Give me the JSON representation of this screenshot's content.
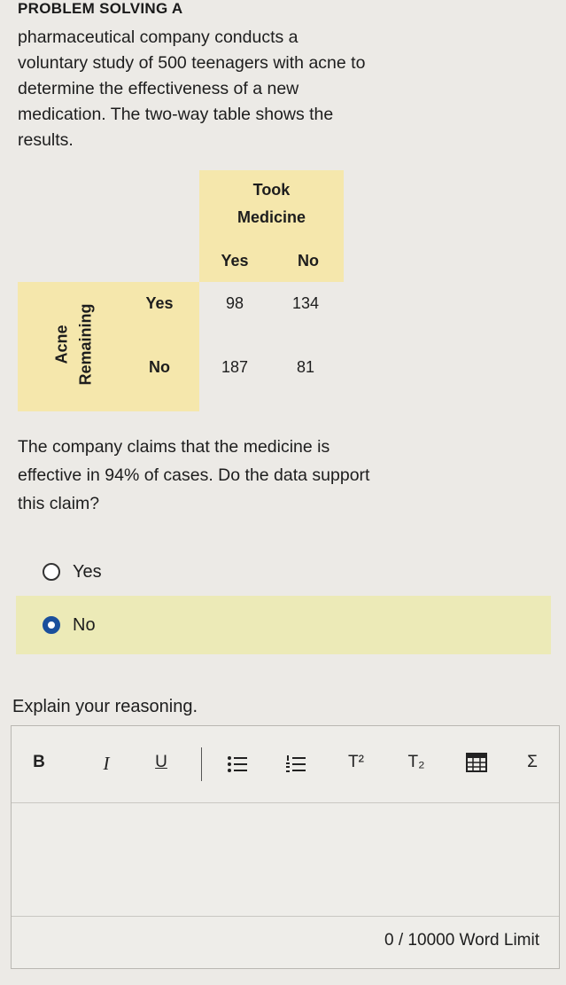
{
  "problem": {
    "title": "PROBLEM SOLVING A",
    "text": "pharmaceutical company conducts a voluntary study of 500 teenagers with acne to determine the effectiveness of a new medication. The two-way table shows the results."
  },
  "two_way_table": {
    "column_header_line1": "Took",
    "column_header_line2": "Medicine",
    "column_yes": "Yes",
    "column_no": "No",
    "row_header_line1": "Acne",
    "row_header_line2": "Remaining",
    "row_yes": "Yes",
    "row_no": "No",
    "cells": {
      "yes_yes": "98",
      "yes_no": "134",
      "no_yes": "187",
      "no_no": "81"
    }
  },
  "question": {
    "text": "The company claims that the medicine is effective in 94% of cases. Do the data support this claim?",
    "options": [
      {
        "label": "Yes",
        "selected": false
      },
      {
        "label": "No",
        "selected": true
      }
    ]
  },
  "explain": {
    "prompt": "Explain your reasoning.",
    "toolbar": {
      "bold": "B",
      "italic": "I",
      "underline": "U",
      "superscript": "T²",
      "subscript": "T₂",
      "sigma": "Σ"
    },
    "word_count": "0 / 10000 Word Limit"
  },
  "colors": {
    "table_header_bg": "#f5e7ac",
    "selected_option_bg": "#eceab7",
    "radio_checked": "#1a4f9c"
  }
}
